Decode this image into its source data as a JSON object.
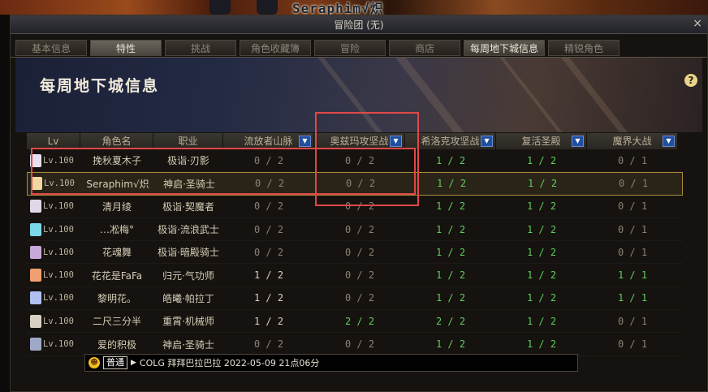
{
  "game": {
    "overhead_name": "Seraphim√炽"
  },
  "window": {
    "title": "冒险团 (无)",
    "close_label": "×"
  },
  "tabs": [
    {
      "label": "基本信息"
    },
    {
      "label": "特性"
    },
    {
      "label": "挑战"
    },
    {
      "label": "角色收藏簿"
    },
    {
      "label": "冒险"
    },
    {
      "label": "商店"
    },
    {
      "label": "每周地下城信息"
    },
    {
      "label": "精锐角色"
    }
  ],
  "page": {
    "title": "每周地下城信息",
    "help_icon": "?"
  },
  "table": {
    "headers": [
      "Lv",
      "角色名",
      "职业",
      "流放者山脉",
      "奥兹玛攻坚战",
      "希洛克攻坚战",
      "复活圣殿",
      "魔界大战"
    ],
    "rows": [
      {
        "lv": "Lv.100",
        "name": "挽秋夏木子",
        "job": "极诣·刃影",
        "s": [
          "0 / 2",
          "0 / 2",
          "1 / 2",
          "1 / 2",
          "0 / 1"
        ],
        "avatar": "#e8e0f0"
      },
      {
        "lv": "Lv.100",
        "name": "Seraphim√炽",
        "job": "神启·圣骑士",
        "s": [
          "0 / 2",
          "0 / 2",
          "1 / 2",
          "1 / 2",
          "0 / 1"
        ],
        "avatar": "#f0d8a0"
      },
      {
        "lv": "Lv.100",
        "name": "清月绫",
        "job": "极诣·契魔者",
        "s": [
          "0 / 2",
          "0 / 2",
          "1 / 2",
          "1 / 2",
          "0 / 1"
        ],
        "avatar": "#e0d8e8"
      },
      {
        "lv": "Lv.100",
        "name": "…凇梅°",
        "job": "极诣·流浪武士",
        "s": [
          "0 / 2",
          "0 / 2",
          "1 / 2",
          "1 / 2",
          "0 / 1"
        ],
        "avatar": "#7ad8e8"
      },
      {
        "lv": "Lv.100",
        "name": "花魂舞",
        "job": "极诣·暗殿骑士",
        "s": [
          "0 / 2",
          "0 / 2",
          "1 / 2",
          "1 / 2",
          "0 / 1"
        ],
        "avatar": "#c8a8d8"
      },
      {
        "lv": "Lv.100",
        "name": "花花是FaFa",
        "job": "归元·气功师",
        "s": [
          "1 / 2",
          "0 / 2",
          "1 / 2",
          "1 / 2",
          "1 / 1"
        ],
        "avatar": "#f0a070"
      },
      {
        "lv": "Lv.100",
        "name": "黎明花。",
        "job": "皓曦·帕拉丁",
        "s": [
          "1 / 2",
          "0 / 2",
          "1 / 2",
          "1 / 2",
          "1 / 1"
        ],
        "avatar": "#b0c0f0"
      },
      {
        "lv": "Lv.100",
        "name": "二尺三分半",
        "job": "重霄·机械师",
        "s": [
          "1 / 2",
          "2 / 2",
          "2 / 2",
          "1 / 2",
          "0 / 1"
        ],
        "avatar": "#d8d0c0"
      },
      {
        "lv": "Lv.100",
        "name": "爱的积极",
        "job": "神启·圣骑士",
        "s": [
          "0 / 2",
          "0 / 2",
          "1 / 2",
          "1 / 2",
          "0 / 1"
        ],
        "avatar": "#a0a8c8"
      }
    ]
  },
  "chat": {
    "channel": "普通",
    "message": "COLG 拜拜巴拉巴拉 2022-05-09 21点06分"
  },
  "colors": {
    "done": "#5cd05c",
    "highlight": "#e04848",
    "selected_border": "#a88a3a"
  }
}
